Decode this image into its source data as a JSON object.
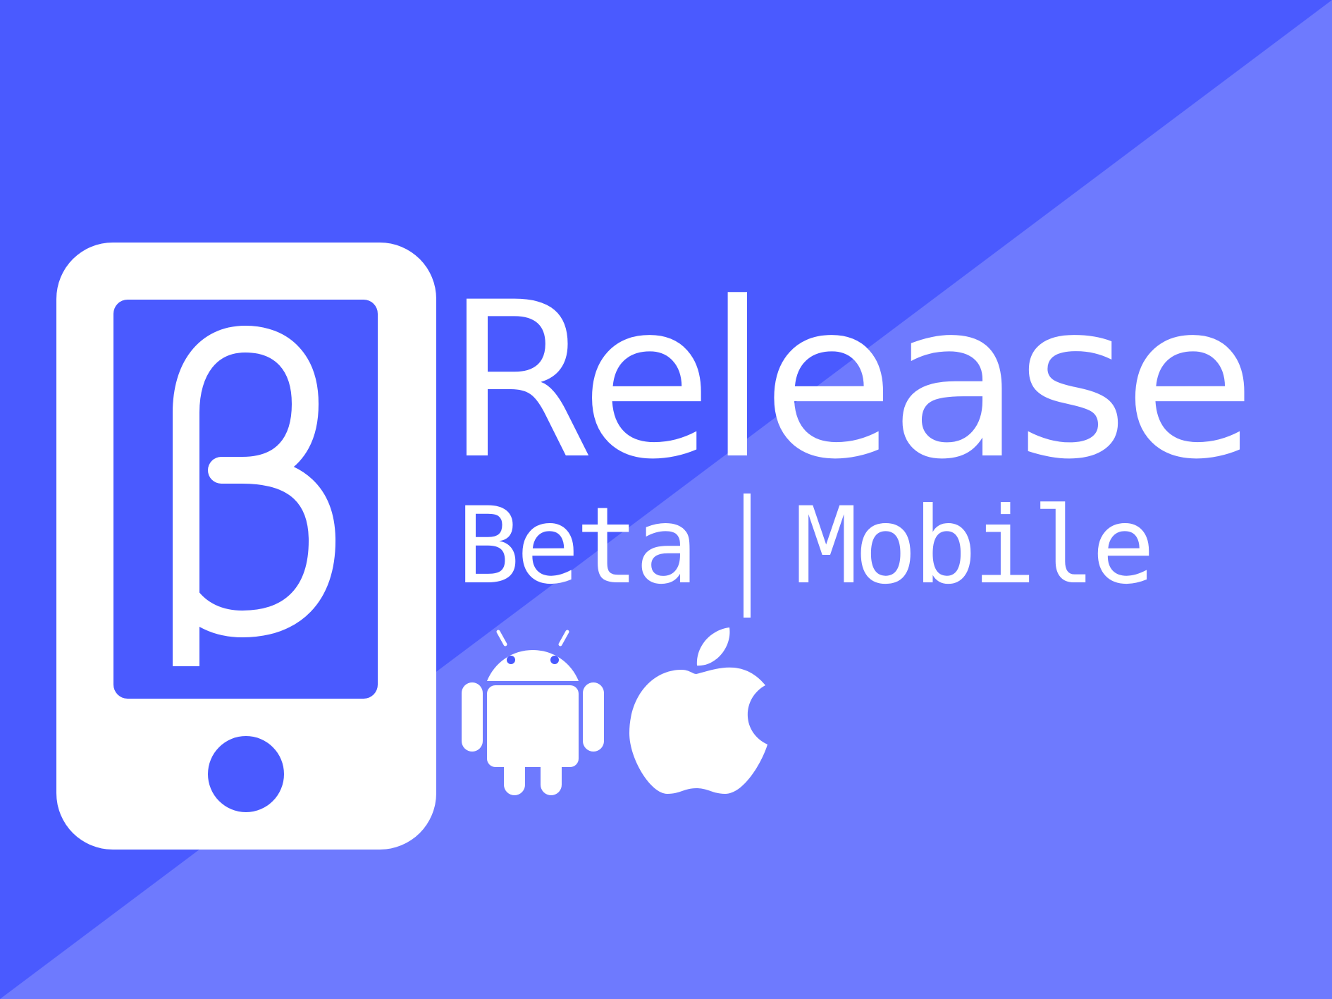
{
  "brand": {
    "title": "Release",
    "subtitle_left": "Beta",
    "subtitle_right": "Mobile",
    "logo_glyph": "β"
  },
  "colors": {
    "background_primary": "#4a5aff",
    "background_secondary": "#6e7afe",
    "foreground": "#ffffff"
  },
  "icons": {
    "logo": "phone-beta-logo-icon",
    "platforms": [
      "android-icon",
      "apple-icon"
    ]
  }
}
